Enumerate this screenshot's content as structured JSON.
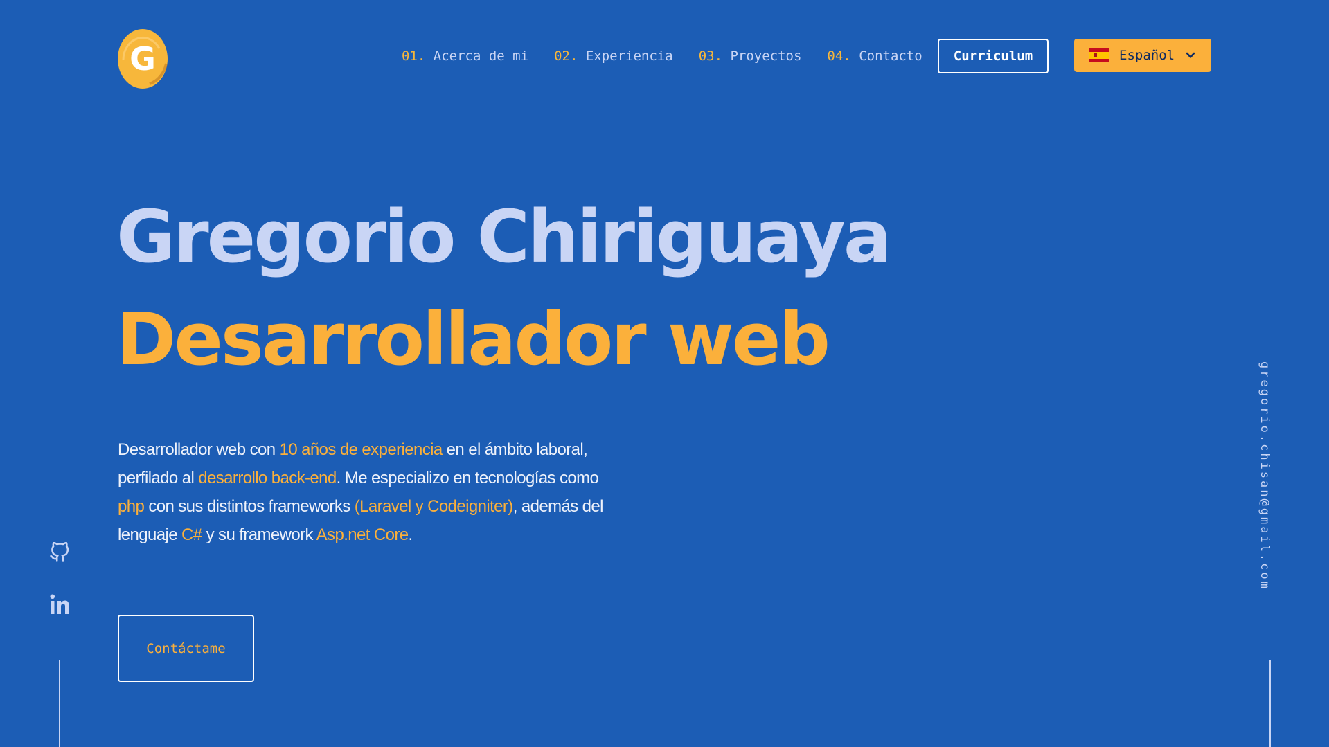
{
  "logo": {
    "letter": "G"
  },
  "nav": {
    "items": [
      {
        "num": "01.",
        "label": "Acerca de mi"
      },
      {
        "num": "02.",
        "label": "Experiencia"
      },
      {
        "num": "03.",
        "label": "Proyectos"
      },
      {
        "num": "04.",
        "label": "Contacto"
      }
    ],
    "cv_label": "Curriculum",
    "language": {
      "selected": "Español",
      "icon": "spain-flag-icon"
    }
  },
  "hero": {
    "name": "Gregorio Chiriguaya",
    "role": "Desarrollador web",
    "description": {
      "t1": "Desarrollador web con ",
      "h1": "10 años de experiencia",
      "t2": " en el ámbito laboral, perfilado al ",
      "h2": "desarrollo back-end",
      "t3": ". Me especializo en tecnologías como ",
      "h3": "php",
      "t4": " con sus distintos frameworks ",
      "h4": "(Laravel y Codeigniter)",
      "t5": ", además del lenguaje ",
      "h5": "C#",
      "t6": " y su framework ",
      "h6": "Asp.net Core",
      "t7": "."
    },
    "cta_label": "Contáctame"
  },
  "social": {
    "links": [
      {
        "icon": "github-icon"
      },
      {
        "icon": "linkedin-icon"
      }
    ]
  },
  "email": "gregorio.chisan@gmail.com",
  "colors": {
    "background": "#1c5db5",
    "accent": "#fbb03b",
    "text_light": "#c9d5f5",
    "text_white": "#ffffff"
  }
}
